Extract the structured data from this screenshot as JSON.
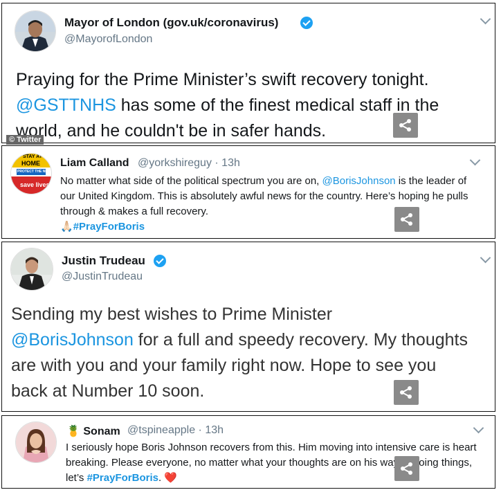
{
  "tweets": [
    {
      "name": "Mayor of London (gov.uk/coronavirus)",
      "handle": "@MayorofLondon",
      "text_before": "Praying for the Prime Minister’s swift recovery tonight.",
      "mention": "@GSTTNHS",
      "text_after": " has some of the finest medical staff in the world, and he couldn't be in safer hands."
    },
    {
      "name": "Liam Calland",
      "handle": "@yorkshireguy",
      "time": " · 13h",
      "text_before": "No matter what side of the political spectrum you are on, ",
      "mention": "@BorisJohnson",
      "text_after": " is the leader of our United Kingdom. This is absolutely awful news for the country. Here’s hoping he pulls through & makes a full recovery.",
      "emoji": "🙏🏻",
      "hashtag": "#PrayForBoris",
      "avatar_lines": [
        "STAY AT",
        "HOME",
        "PROTECT THE NHS",
        "save lives"
      ]
    },
    {
      "name": "Justin Trudeau",
      "handle": "@JustinTrudeau",
      "text_before": "Sending my best wishes to Prime Minister ",
      "mention": "@BorisJohnson",
      "text_after": " for a full and speedy recovery. My thoughts are with you and your family right now. Hope to see you back at Number 10 soon."
    },
    {
      "name_emoji": "🍍",
      "name": "Sonam",
      "handle": "@tspineapple",
      "time": " · 13h",
      "text_before": "I seriously hope Boris Johnson recovers from this. Him moving into intensive care is heart breaking. Please everyone, no matter what your thoughts are on his way of doing things, let’s ",
      "hashtag": "#PrayForBoris",
      "text_after": ". ",
      "heart": "❤️"
    }
  ],
  "watermark": "© Twitter",
  "colors": {
    "link": "#1b95e0",
    "verified": "#1da1f2",
    "share_bg": "#8a8a8a"
  },
  "icons": {
    "share": "share-icon",
    "chevron": "chevron-down-icon",
    "verified": "verified-badge-icon"
  }
}
